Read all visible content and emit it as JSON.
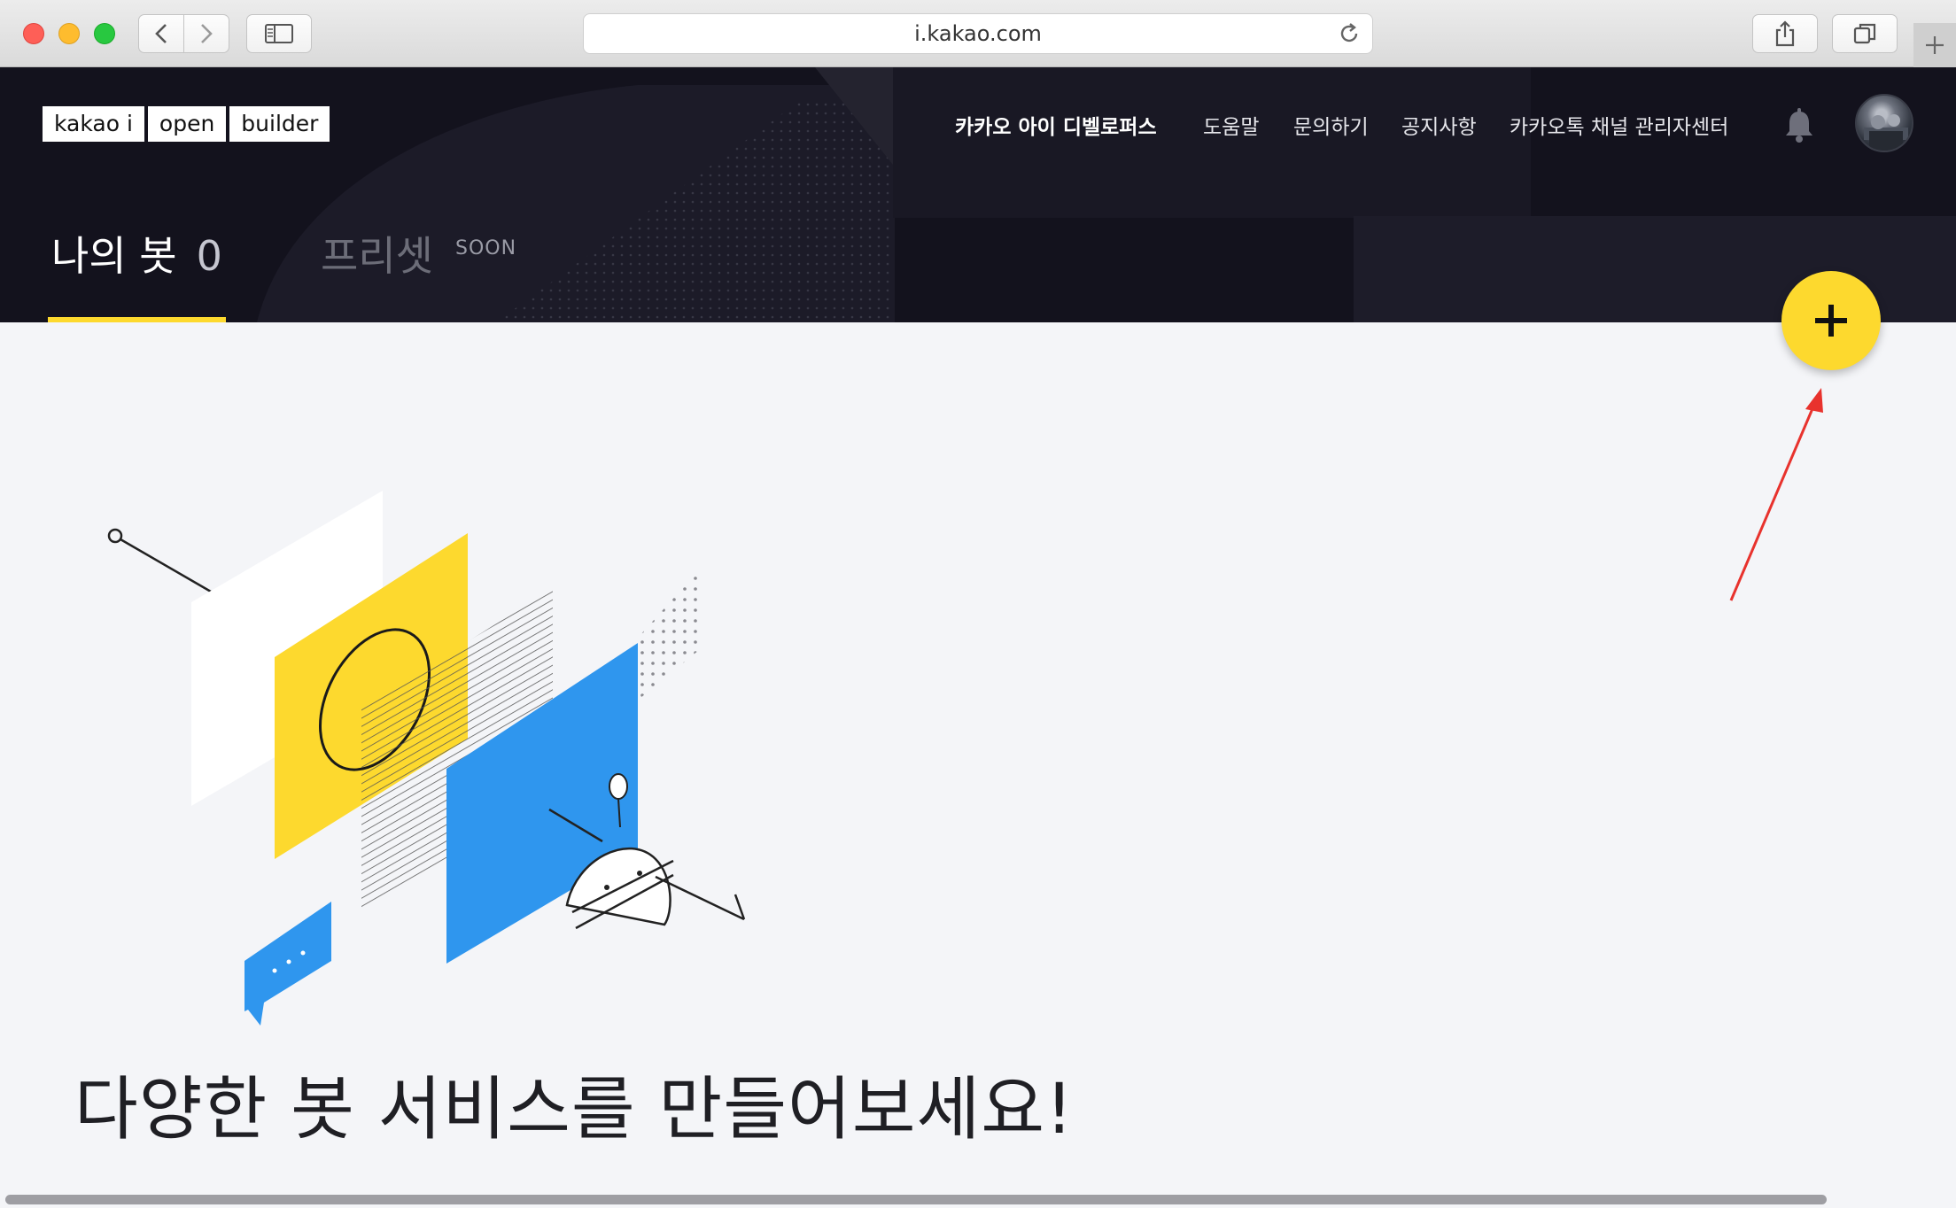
{
  "browser": {
    "url": "i.kakao.com"
  },
  "header": {
    "logo": [
      "kakao i",
      "open",
      "builder"
    ],
    "nav": [
      "카카오 아이 디벨로퍼스",
      "도움말",
      "문의하기",
      "공지사항",
      "카카오톡 채널 관리자센터"
    ],
    "tabs": {
      "my_bots_label": "나의 봇",
      "my_bots_count": "0",
      "preset_label": "프리셋",
      "preset_badge": "SOON"
    }
  },
  "fab": {
    "icon": "plus-icon",
    "color": "#fdd92e"
  },
  "main": {
    "headline": "다양한 봇 서비스를 만들어보세요!"
  },
  "colors": {
    "header_bg": "#13121d",
    "accent_yellow": "#fdd92e",
    "illustration_blue": "#2f96ee",
    "annotation_red": "#e8322d",
    "page_bg": "#f4f5f8"
  }
}
